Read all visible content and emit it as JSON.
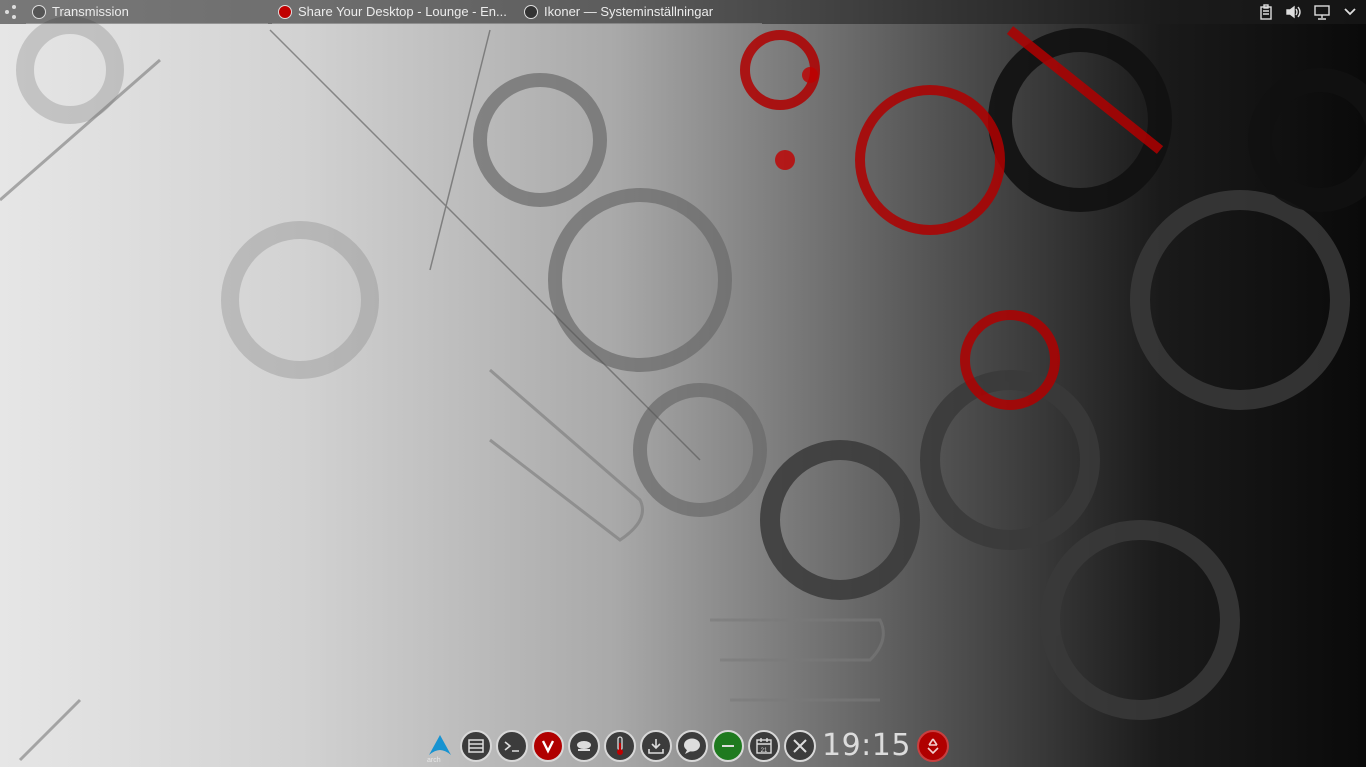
{
  "topbar": {
    "launcher_icon": "application-launcher-icon",
    "tasks": [
      {
        "label": "Transmission",
        "icon": "transmission-icon"
      },
      {
        "label": "Share Your Desktop - Lounge - En...",
        "icon": "vivaldi-icon"
      },
      {
        "label": "Ikoner  — Systeminställningar",
        "icon": "system-settings-icon"
      }
    ],
    "tray": [
      {
        "icon": "clipboard-icon"
      },
      {
        "icon": "volume-icon"
      },
      {
        "icon": "network-icon"
      },
      {
        "icon": "chevron-down-icon"
      }
    ]
  },
  "dock": {
    "arch_label": "arch",
    "items": [
      {
        "icon": "arch-linux-icon"
      },
      {
        "icon": "file-manager-icon"
      },
      {
        "icon": "terminal-icon"
      },
      {
        "icon": "vivaldi-icon"
      },
      {
        "icon": "coffee-cup-icon"
      },
      {
        "icon": "thermometer-icon"
      },
      {
        "icon": "download-icon"
      },
      {
        "icon": "chat-bubble-icon"
      },
      {
        "icon": "green-status-icon"
      },
      {
        "icon": "calendar-icon",
        "label": "21"
      },
      {
        "icon": "tools-icon"
      }
    ],
    "clock": "19:15",
    "trash_icon": "recycle-icon"
  },
  "colors": {
    "accent_red": "#c00000",
    "status_green": "#1f7a1f",
    "arch_blue": "#1793d1"
  }
}
